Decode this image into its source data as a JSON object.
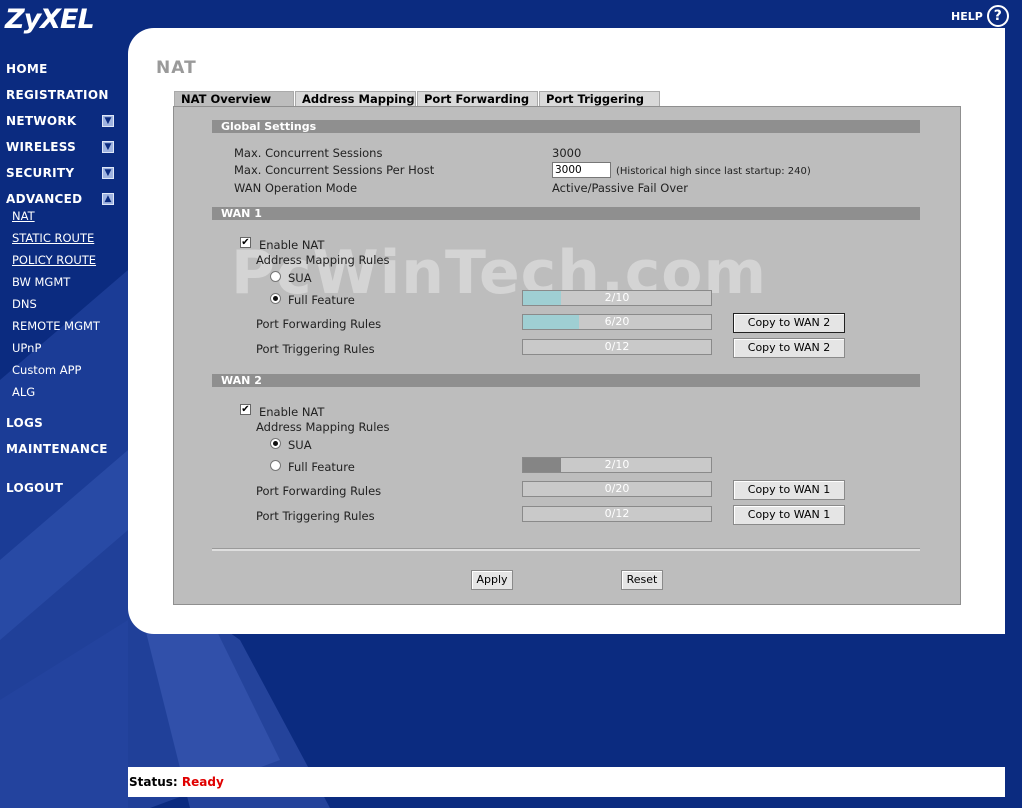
{
  "brand": {
    "logo": "ZyXEL",
    "help_label": "HELP",
    "help_symbol": "?"
  },
  "nav": {
    "home": "HOME",
    "registration": "REGISTRATION",
    "network": "NETWORK",
    "wireless": "WIRELESS",
    "security": "SECURITY",
    "advanced": "ADVANCED",
    "advanced_sub": [
      "NAT",
      "STATIC ROUTE",
      "POLICY ROUTE",
      "BW MGMT",
      "DNS",
      "REMOTE MGMT",
      "UPnP",
      "Custom APP",
      "ALG"
    ],
    "logs": "LOGS",
    "maintenance": "MAINTENANCE",
    "logout": "LOGOUT"
  },
  "page": {
    "title": "NAT"
  },
  "tabs": [
    "NAT Overview",
    "Address Mapping",
    "Port Forwarding",
    "Port Triggering"
  ],
  "global": {
    "header": "Global Settings",
    "max_sessions_label": "Max. Concurrent Sessions",
    "max_sessions_value": "3000",
    "per_host_label": "Max. Concurrent Sessions Per Host",
    "per_host_value": "3000",
    "per_host_note": "(Historical high since last startup: 240)",
    "wan_mode_label": "WAN Operation Mode",
    "wan_mode_value": "Active/Passive Fail Over"
  },
  "wan1": {
    "header": "WAN 1",
    "enable_nat_label": "Enable NAT",
    "enable_nat_checked": true,
    "addr_rules_label": "Address Mapping Rules",
    "sua_label": "SUA",
    "full_label": "Full Feature",
    "selected_mode": "Full Feature",
    "addr_bar": {
      "text": "2/10",
      "used": 2,
      "max": 10,
      "color": "#9fcfd3"
    },
    "pf_label": "Port Forwarding Rules",
    "pf_bar": {
      "text": "6/20",
      "used": 6,
      "max": 20,
      "color": "#9fcfd3"
    },
    "pt_label": "Port Triggering Rules",
    "pt_bar": {
      "text": "0/12",
      "used": 0,
      "max": 12,
      "color": "#9fcfd3"
    },
    "copy_button": "Copy to WAN 2"
  },
  "wan2": {
    "header": "WAN 2",
    "enable_nat_label": "Enable NAT",
    "enable_nat_checked": true,
    "addr_rules_label": "Address Mapping Rules",
    "sua_label": "SUA",
    "full_label": "Full Feature",
    "selected_mode": "SUA",
    "addr_bar": {
      "text": "2/10",
      "used": 2,
      "max": 10,
      "color": "#858585"
    },
    "pf_label": "Port Forwarding Rules",
    "pf_bar": {
      "text": "0/20",
      "used": 0,
      "max": 20,
      "color": "#858585"
    },
    "pt_label": "Port Triggering Rules",
    "pt_bar": {
      "text": "0/12",
      "used": 0,
      "max": 12,
      "color": "#858585"
    },
    "copy_button": "Copy to WAN 1"
  },
  "actions": {
    "apply": "Apply",
    "reset": "Reset"
  },
  "watermark": "PcWinTech.com",
  "status": {
    "label": "Status:",
    "value": "Ready"
  }
}
